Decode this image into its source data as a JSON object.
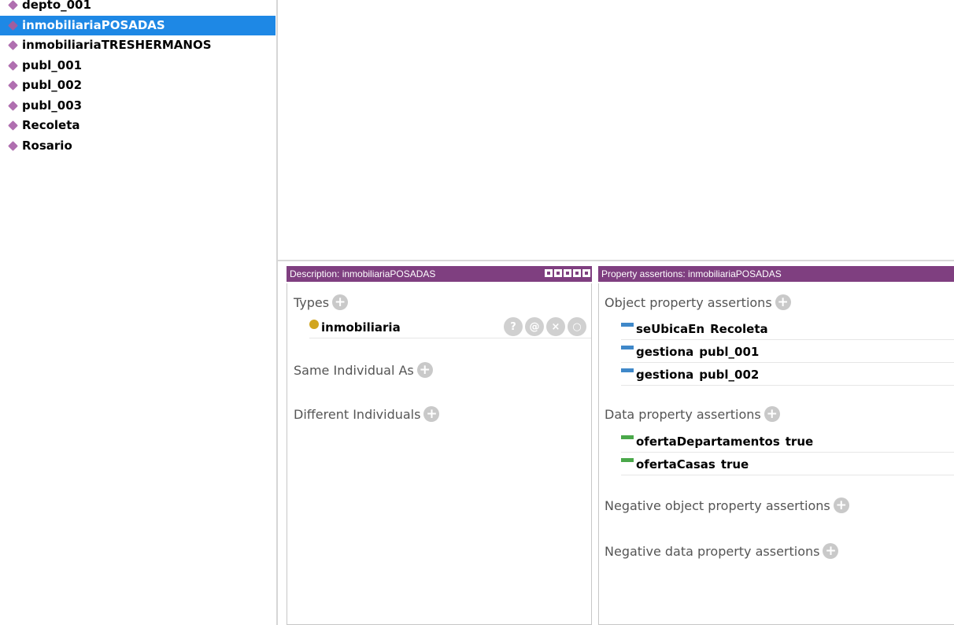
{
  "individuals": [
    {
      "name": "depto_001"
    },
    {
      "name": "inmobiliariaPOSADAS",
      "selected": true
    },
    {
      "name": "inmobiliariaTRESHERMANOS"
    },
    {
      "name": "publ_001"
    },
    {
      "name": "publ_002"
    },
    {
      "name": "publ_003"
    },
    {
      "name": "Recoleta"
    },
    {
      "name": "Rosario"
    }
  ],
  "description": {
    "header": "Description: inmobiliariaPOSADAS",
    "types_label": "Types",
    "types": [
      {
        "name": "inmobiliaria",
        "actions": [
          "?",
          "@",
          "×",
          "○"
        ]
      }
    ],
    "same_label": "Same Individual As",
    "different_label": "Different Individuals"
  },
  "properties": {
    "header": "Property assertions: inmobiliariaPOSADAS",
    "object_label": "Object property assertions",
    "object": [
      {
        "property": "seUbicaEn",
        "value": "Recoleta"
      },
      {
        "property": "gestiona",
        "value": "publ_001"
      },
      {
        "property": "gestiona",
        "value": "publ_002"
      }
    ],
    "data_label": "Data property assertions",
    "data": [
      {
        "property": "ofertaDepartamentos",
        "value": "true"
      },
      {
        "property": "ofertaCasas",
        "value": "true"
      }
    ],
    "neg_object_label": "Negative object property assertions",
    "neg_data_label": "Negative data property assertions"
  },
  "colors": {
    "selection": "#1e88e5",
    "header": "#7f3f80",
    "individual_icon": "#b06fb0",
    "class_icon": "#d1a51e",
    "object_property_icon": "#3f88c9",
    "data_property_icon": "#4aa84a"
  }
}
